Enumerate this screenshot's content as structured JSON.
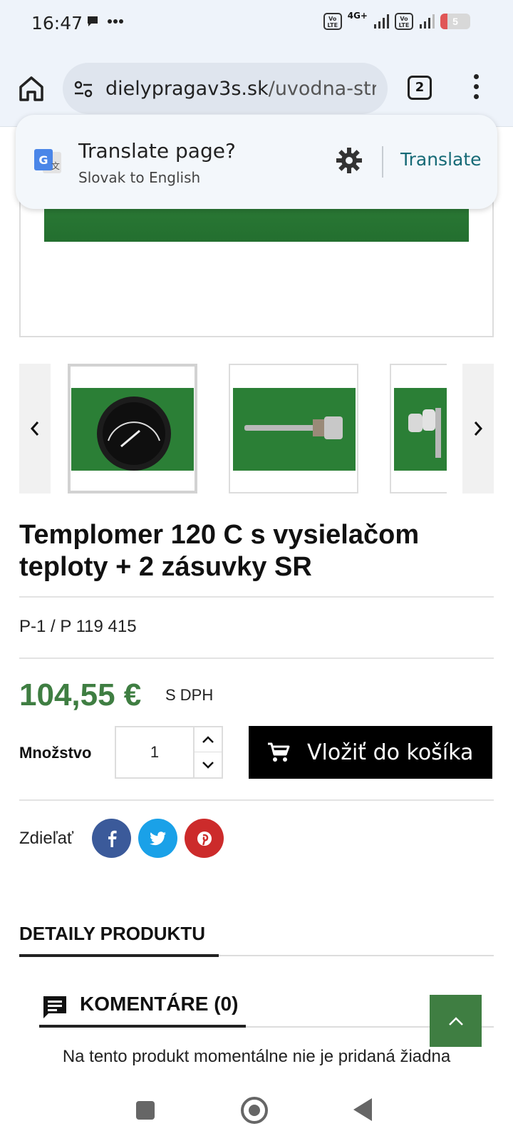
{
  "status_bar": {
    "time": "16:47",
    "left_icons": [
      "chat-bubble-icon",
      "more-dots-icon"
    ],
    "network_4g": "4G+",
    "volte_label": "Vo LTE",
    "battery": "5"
  },
  "browser": {
    "url_domain": "dielypragav3s.sk",
    "url_path": "/uvodna-strana",
    "tab_count": "2"
  },
  "translate_popup": {
    "title": "Translate page?",
    "subtitle": "Slovak to English",
    "button": "Translate"
  },
  "product": {
    "title": "Templomer 120 C s vysielačom teploty + 2 zásuvky SR",
    "reference": "P-1 / P 119 415",
    "price": "104,55 €",
    "tax_label": "S DPH",
    "quantity_label": "Množstvo",
    "quantity": "1",
    "add_to_cart": "Vložiť do košíka",
    "share_label": "Zdieľať"
  },
  "tabs": {
    "details": "DETAILY PRODUKTU",
    "comments": "KOMENTÁRE (0)",
    "comments_empty": "Na tento produkt momentálne nie je pridaná žiadna"
  },
  "colors": {
    "price_green": "#3f7e42",
    "translate_teal": "#166a76",
    "facebook": "#3b5a9a",
    "twitter": "#1aa1e8",
    "pinterest": "#cc2b2b"
  }
}
